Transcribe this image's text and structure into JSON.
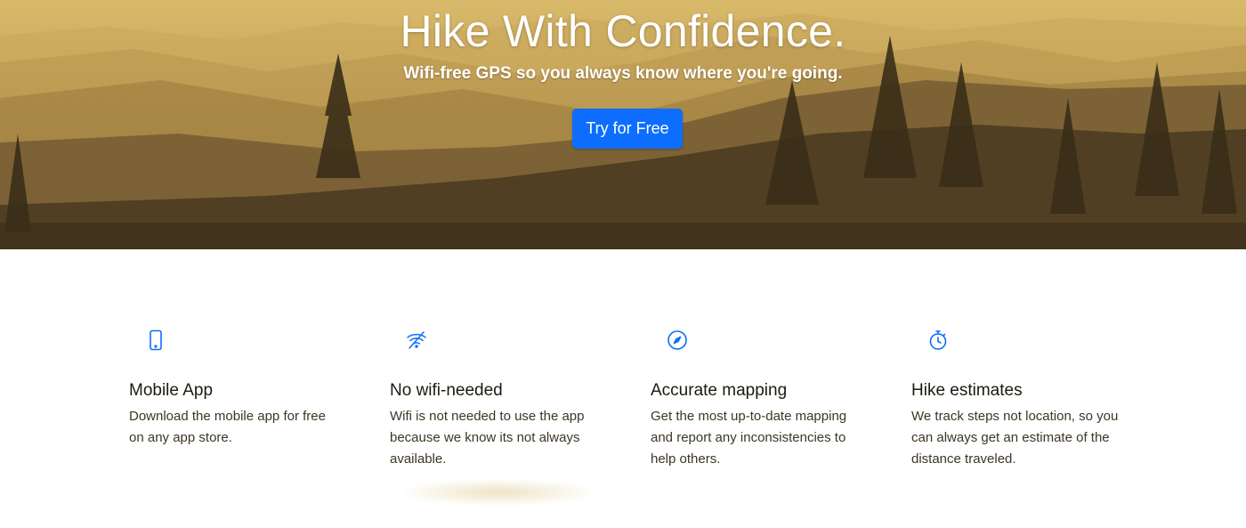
{
  "hero": {
    "title": "Hike With Confidence.",
    "subtitle": "Wifi-free GPS so you always know where you're going.",
    "cta_label": "Try for Free"
  },
  "features": [
    {
      "icon": "mobile-phone-icon",
      "title": "Mobile App",
      "text": "Download the mobile app for free on any app store."
    },
    {
      "icon": "wifi-off-icon",
      "title": "No wifi-needed",
      "text": "Wifi is not needed to use the app because we know its not always available."
    },
    {
      "icon": "compass-icon",
      "title": "Accurate mapping",
      "text": "Get the most up-to-date mapping and report any inconsistencies to help others."
    },
    {
      "icon": "stopwatch-icon",
      "title": "Hike estimates",
      "text": "We track steps not location, so you can always get an estimate of the distance traveled."
    }
  ],
  "colors": {
    "accent": "#0d6efd",
    "hero_light": "#d9b96a",
    "hero_dark": "#3f321c",
    "heading": "#1d1a10",
    "body_text": "#3c3624"
  }
}
